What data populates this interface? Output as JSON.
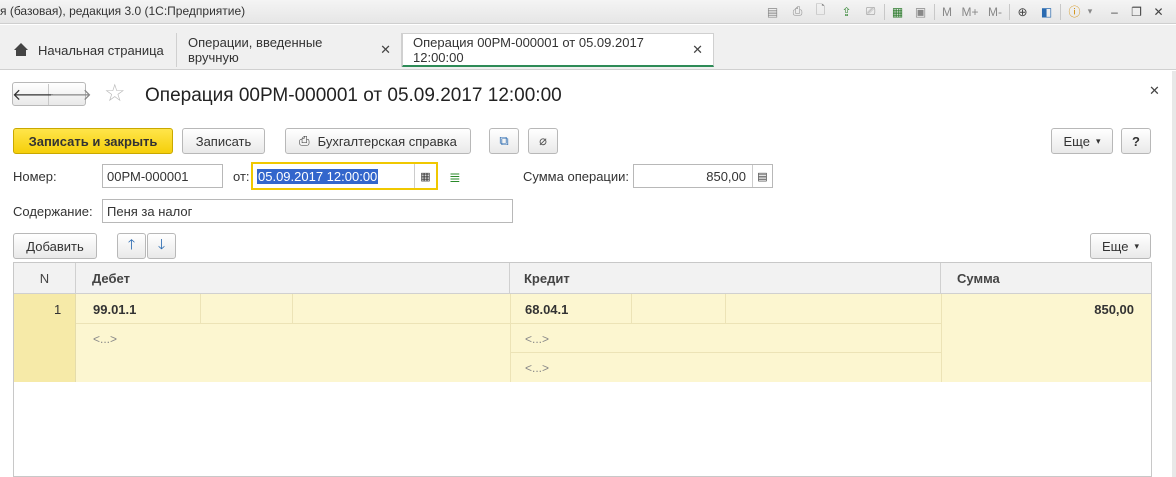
{
  "window": {
    "title": "я (базовая), редакция 3.0  (1С:Предприятие)"
  },
  "tabs": [
    {
      "label": "Начальная страница"
    },
    {
      "label": "Операции, введенные вручную"
    },
    {
      "label": "Операция 00РМ-000001 от 05.09.2017 12:00:00"
    }
  ],
  "toolbar_icons": [
    "save-icon",
    "print-icon",
    "preview-icon",
    "upload-icon",
    "download-icon",
    "calculator-icon",
    "calendar-icon",
    "zoom-icon",
    "panel-icon",
    "info-icon"
  ],
  "memory": {
    "m": "M",
    "m_plus": "M+",
    "m_minus": "M-"
  },
  "form": {
    "title": "Операция 00РМ-000001 от 05.09.2017 12:00:00",
    "buttons": {
      "save_close": "Записать и закрыть",
      "save": "Записать",
      "report": "Бухгалтерская справка",
      "more": "Еще",
      "help": "?"
    },
    "fields": {
      "number_label": "Номер:",
      "number_value": "00РМ-000001",
      "date_label": "от:",
      "date_value": "05.09.2017 12:00:00",
      "sum_label": "Сумма операции:",
      "sum_value": "850,00",
      "content_label": "Содержание:",
      "content_value": "Пеня за налог"
    },
    "table_toolbar": {
      "add": "Добавить",
      "more": "Еще"
    },
    "table": {
      "columns": [
        "N",
        "Дебет",
        "Кредит",
        "Сумма"
      ],
      "rows": [
        {
          "n": "1",
          "debit": "99.01.1",
          "debit_sub1": "<...>",
          "credit": "68.04.1",
          "credit_sub1": "<...>",
          "credit_sub2": "<...>",
          "amount": "850,00"
        }
      ]
    }
  },
  "colors": {
    "primary_button": "#f5cf0a",
    "row_highlight": "#fcf6d0",
    "active_tab_underline": "#2e8b57",
    "focused_border": "#f0c800"
  }
}
